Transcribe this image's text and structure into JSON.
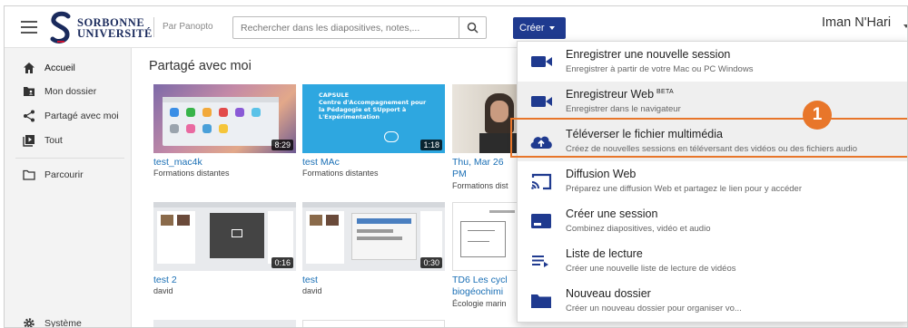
{
  "topbar": {
    "brand_line1": "SORBONNE",
    "brand_line2": "UNIVERSITÉ",
    "by_panopto": "Par Panopto",
    "search_placeholder": "Rechercher dans les diapositives, notes,...",
    "create_label": "Créer",
    "user_name": "Iman N'Hari"
  },
  "sidebar": {
    "items": [
      {
        "label": "Accueil",
        "icon": "home-icon"
      },
      {
        "label": "Mon dossier",
        "icon": "folder-user-icon"
      },
      {
        "label": "Partagé avec moi",
        "icon": "share-icon"
      },
      {
        "label": "Tout",
        "icon": "video-library-icon"
      },
      {
        "label": "Parcourir",
        "icon": "folder-outline-icon"
      },
      {
        "label": "Système",
        "icon": "gear-icon"
      }
    ]
  },
  "main": {
    "title": "Partagé avec moi",
    "cards": [
      {
        "title": "test_mac4k",
        "subtitle": "Formations distantes",
        "duration": "8:29"
      },
      {
        "title": "test MAc",
        "subtitle": "Formations distantes",
        "duration": "1:18",
        "thumb_text": "CAPSULE\nCentre d'Accompagnement pour la Pédagogie et SUpport à L'Expérimentation"
      },
      {
        "title": "Thu, Mar 26",
        "title2": "PM",
        "subtitle": "Formations dist"
      },
      {
        "title": "test 2",
        "subtitle": "david",
        "duration": "0:16"
      },
      {
        "title": "test",
        "subtitle": "david",
        "duration": "0:30"
      },
      {
        "title": "TD6 Les cycl",
        "title2": "biogéochimi",
        "subtitle": "Écologie marin"
      }
    ]
  },
  "dropdown": {
    "items": [
      {
        "title": "Enregistrer une nouvelle session",
        "desc": "Enregistrer à partir de votre Mac ou PC Windows",
        "icon": "video-camera-icon"
      },
      {
        "title": "Enregistreur Web",
        "badge": "BETA",
        "desc": "Enregistrer dans le navigateur",
        "icon": "video-camera-icon"
      },
      {
        "title": "Téléverser le fichier multimédia",
        "desc": "Créez de nouvelles sessions en téléversant des vidéos ou des fichiers audio",
        "icon": "cloud-upload-icon"
      },
      {
        "title": "Diffusion Web",
        "desc": "Préparez une diffusion Web et partagez le lien pour y accéder",
        "icon": "cast-icon"
      },
      {
        "title": "Créer une session",
        "desc": "Combinez diapositives, vidéo et audio",
        "icon": "session-icon"
      },
      {
        "title": "Liste de lecture",
        "desc": "Créer une nouvelle liste de lecture de vidéos",
        "icon": "playlist-add-icon"
      },
      {
        "title": "Nouveau dossier",
        "desc": "Créer un nouveau dossier pour organiser vo...",
        "icon": "folder-icon"
      }
    ]
  },
  "annotation": {
    "step_number": "1",
    "color": "#e8762a"
  },
  "colors": {
    "primary": "#1f3a8f",
    "link": "#1a6fb5",
    "accent": "#e8762a"
  }
}
